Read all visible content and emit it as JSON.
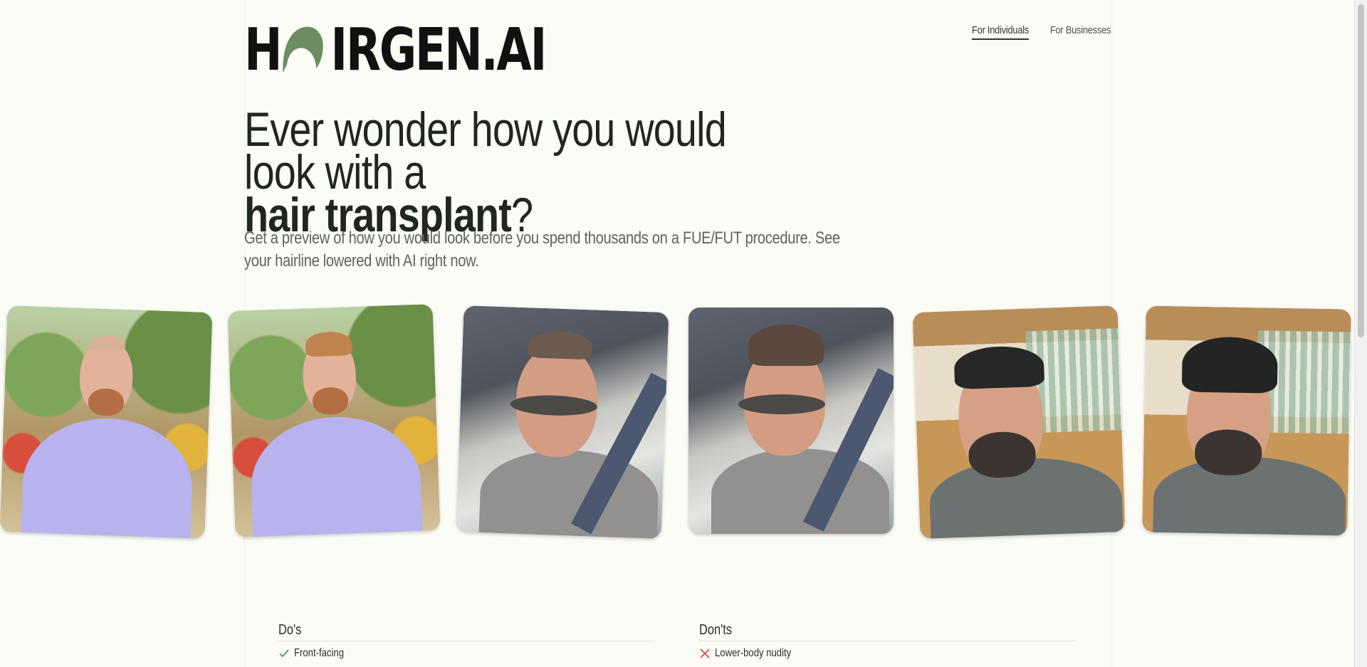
{
  "brand": {
    "before_hair": "H",
    "after_hair": "IRGEN.AI",
    "hair_icon_name": "hair-icon",
    "hair_color": "#6c8d64"
  },
  "nav": {
    "items": [
      {
        "label": "For Individuals",
        "active": true
      },
      {
        "label": "For Businesses",
        "active": false
      }
    ]
  },
  "hero": {
    "headline_part1": "Ever wonder how you would look with a",
    "headline_bold": "hair transplant",
    "headline_end": "?",
    "subtitle": "Get a preview of how you would look before you spend thousands on a FUE/FUT procedure. See your hairline lowered with AI right now."
  },
  "gallery": {
    "photos": [
      {
        "name": "photo-1",
        "scene": "park"
      },
      {
        "name": "photo-2",
        "scene": "park"
      },
      {
        "name": "photo-3",
        "scene": "car"
      },
      {
        "name": "photo-4",
        "scene": "car"
      },
      {
        "name": "photo-5",
        "scene": "cafe"
      },
      {
        "name": "photo-6",
        "scene": "cafe"
      }
    ]
  },
  "guidelines": {
    "dos_title": "Do's",
    "dos_item": "Front-facing",
    "donts_title": "Don'ts",
    "donts_item": "Lower-body nudity"
  },
  "icons": {
    "do_icon": "check-icon",
    "dont_icon": "close-icon"
  },
  "colors": {
    "background": "#fcfcf6",
    "text": "#1f2620",
    "hair": "#6c8d64",
    "dont": "#d64646"
  }
}
